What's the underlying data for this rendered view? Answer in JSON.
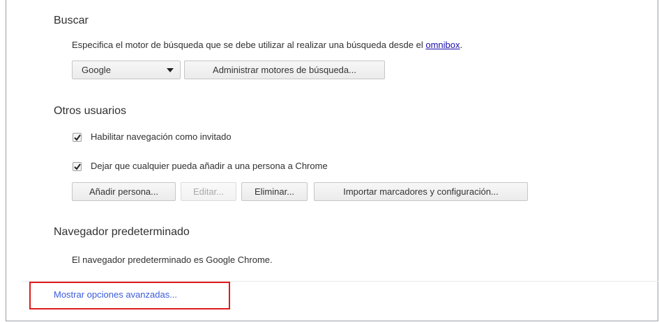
{
  "search": {
    "title": "Buscar",
    "description": "Especifica el motor de búsqueda que se debe utilizar al realizar una búsqueda desde el ",
    "omnibox_link": "omnibox",
    "period": ".",
    "engine_selected": "Google",
    "manage_button": "Administrar motores de búsqueda..."
  },
  "other_users": {
    "title": "Otros usuarios",
    "guest_checkbox_label": "Habilitar navegación como invitado",
    "guest_checked": true,
    "add_anyone_checkbox_label": "Dejar que cualquier pueda añadir a una persona a Chrome",
    "add_anyone_checked": true,
    "add_person_button": "Añadir persona...",
    "edit_button": "Editar...",
    "delete_button": "Eliminar...",
    "import_button": "Importar marcadores y configuración..."
  },
  "default_browser": {
    "title": "Navegador predeterminado",
    "status": "El navegador predeterminado es Google Chrome."
  },
  "advanced": {
    "link_label": "Mostrar opciones avanzadas..."
  },
  "colors": {
    "link_blue": "#1a0dab",
    "advanced_link": "#3b5bdb",
    "highlight_red": "#e01b1b"
  }
}
